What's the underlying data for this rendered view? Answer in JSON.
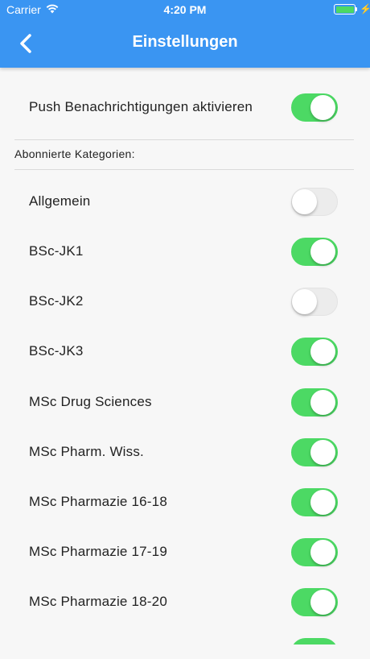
{
  "status_bar": {
    "carrier": "Carrier",
    "time": "4:20 PM"
  },
  "nav": {
    "title": "Einstellungen",
    "back_icon": "chevron-left-icon"
  },
  "push": {
    "label": "Push Benachrichtigungen aktivieren",
    "enabled": true
  },
  "categories": {
    "header": "Abonnierte Kategorien:",
    "items": [
      {
        "label": "Allgemein",
        "enabled": false
      },
      {
        "label": "BSc-JK1",
        "enabled": true
      },
      {
        "label": "BSc-JK2",
        "enabled": false
      },
      {
        "label": "BSc-JK3",
        "enabled": true
      },
      {
        "label": "MSc Drug Sciences",
        "enabled": true
      },
      {
        "label": "MSc Pharm. Wiss.",
        "enabled": true
      },
      {
        "label": "MSc Pharmazie 16-18",
        "enabled": true
      },
      {
        "label": "MSc Pharmazie 17-19",
        "enabled": true
      },
      {
        "label": "MSc Pharmazie 18-20",
        "enabled": true
      }
    ]
  },
  "colors": {
    "nav_background": "#3a95f2",
    "toggle_on": "#4cd964",
    "toggle_off": "#ececec",
    "page_background": "#f7f7f7"
  }
}
